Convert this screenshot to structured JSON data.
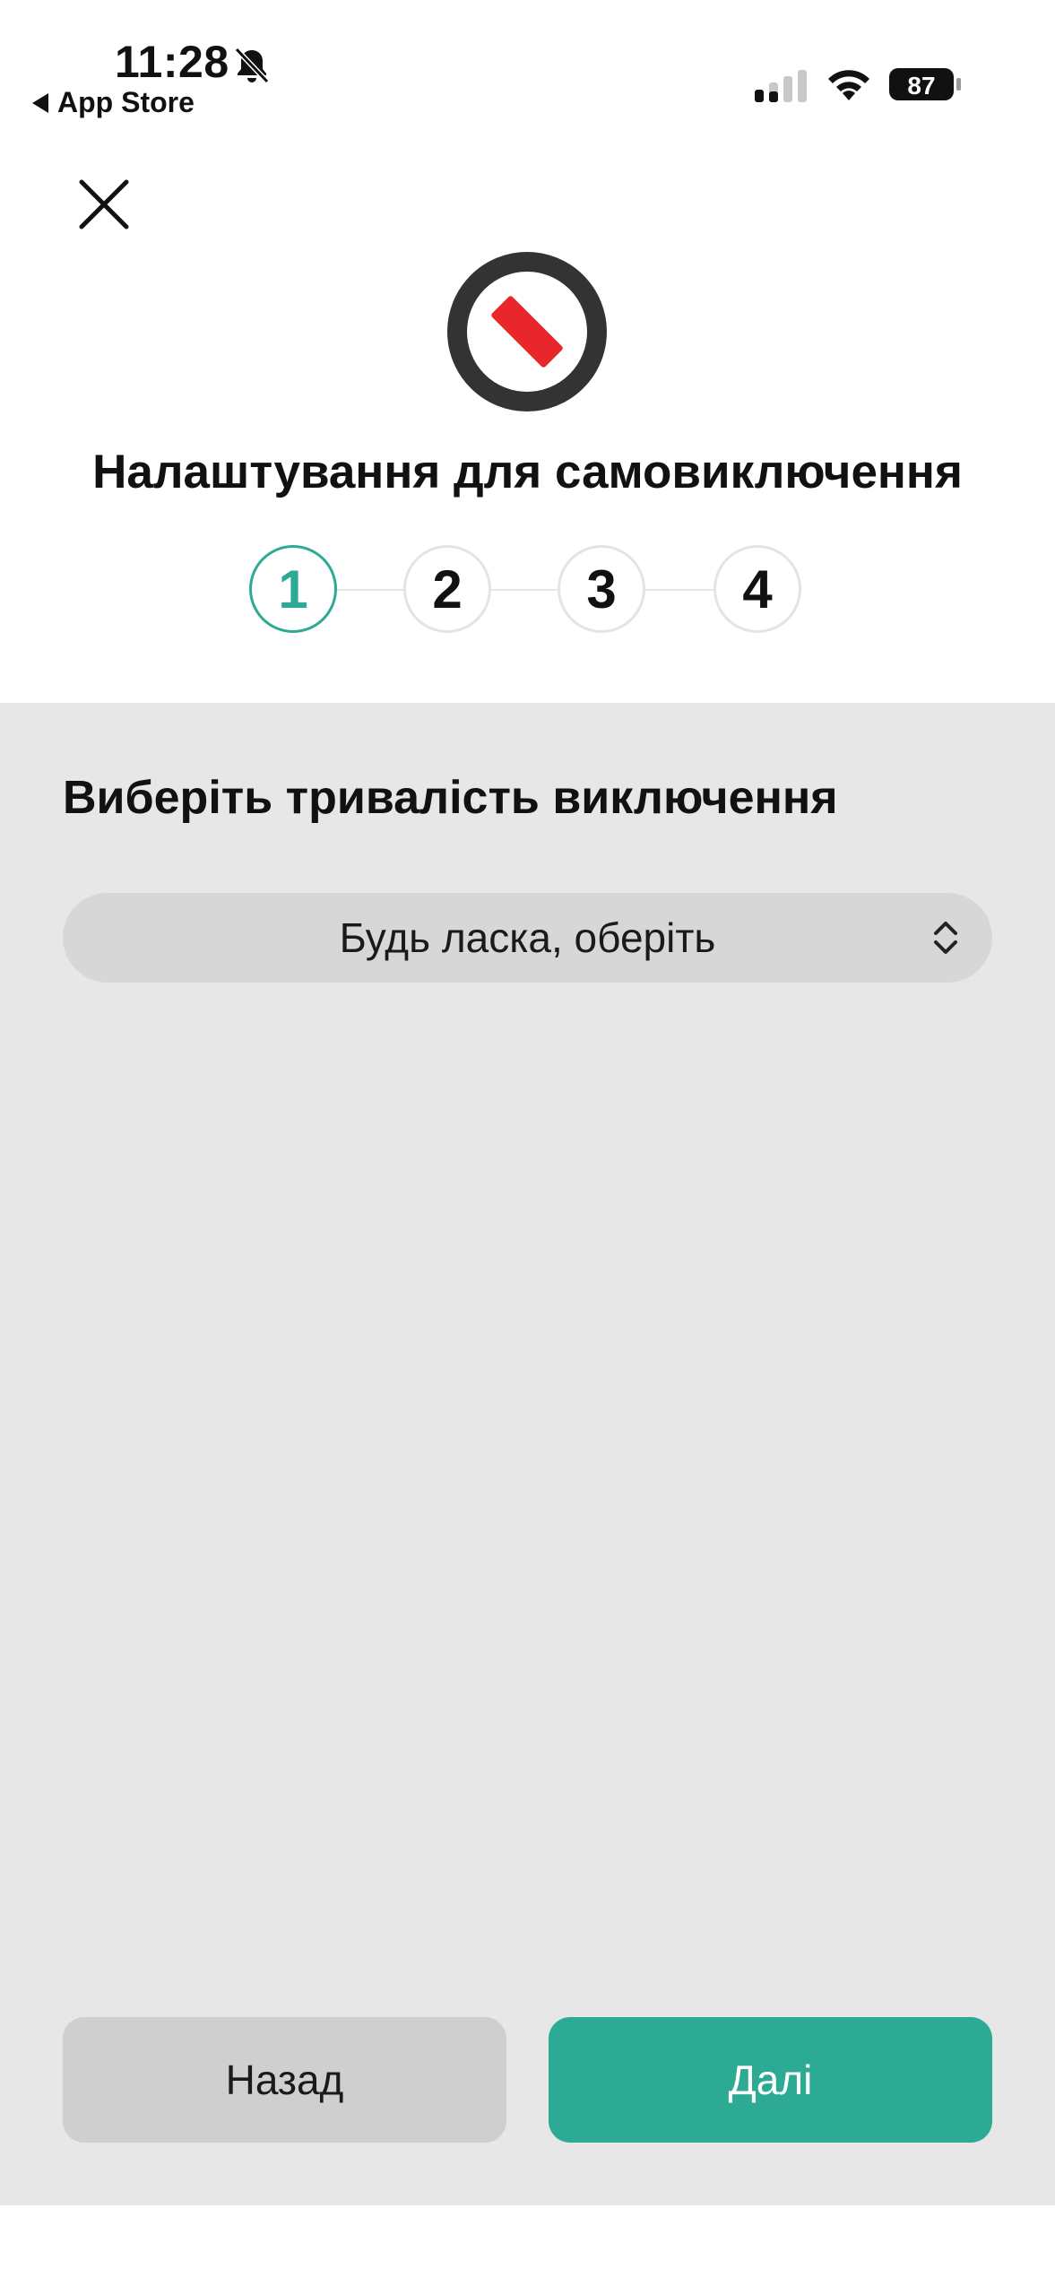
{
  "status_bar": {
    "time": "11:28",
    "back_label": "App Store",
    "battery": "87",
    "icons": [
      "bell-slash-icon",
      "cellular-signal-icon",
      "wifi-icon",
      "battery-icon"
    ]
  },
  "header": {
    "close_icon": "close-icon",
    "logo_icon": "no-entry-icon",
    "title": "Налаштування для самовиключення",
    "steps": [
      "1",
      "2",
      "3",
      "4"
    ],
    "active_step": 1,
    "accent_color": "#2daa94"
  },
  "main": {
    "section_title": "Виберіть тривалість виключення",
    "select": {
      "placeholder": "Будь ласка, оберіть",
      "icon": "chevron-up-down-icon"
    }
  },
  "footer": {
    "back_label": "Назад",
    "next_label": "Далі"
  }
}
